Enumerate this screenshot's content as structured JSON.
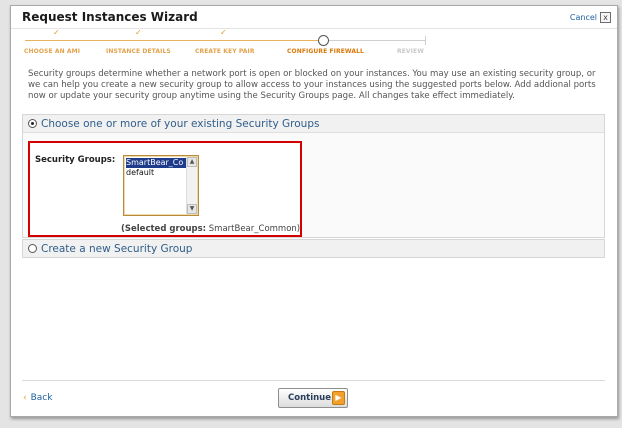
{
  "window": {
    "title": "Request Instances Wizard",
    "cancel_label": "Cancel",
    "close_glyph": "x"
  },
  "steps": [
    {
      "label": "CHOOSE AN AMI",
      "state": "done",
      "mark": "✓"
    },
    {
      "label": "INSTANCE DETAILS",
      "state": "done",
      "mark": "✓"
    },
    {
      "label": "CREATE KEY PAIR",
      "state": "done",
      "mark": "✓"
    },
    {
      "label": "CONFIGURE FIREWALL",
      "state": "current"
    },
    {
      "label": "REVIEW",
      "state": "future"
    }
  ],
  "intro_text": "Security groups determine whether a network port is open or blocked on your instances. You may use an existing security group, or we can help you create a new security group to allow access to your instances using the suggested ports below. Add addional ports now or update your security group anytime using the Security Groups page. All changes take effect immediately.",
  "existing_option": {
    "label": "Choose one or more of your existing Security Groups",
    "selected": true
  },
  "security_groups": {
    "label": "Security Groups:",
    "options": [
      "SmartBear_Co",
      "default"
    ],
    "selected_index": 0,
    "selected_prefix": "(Selected groups:",
    "selected_value": " SmartBear_Common)"
  },
  "new_option": {
    "label": "Create a new Security Group",
    "selected": false
  },
  "footer": {
    "back_label": "Back",
    "back_chevron": "‹",
    "continue_label": "Continue",
    "continue_arrow": "▶"
  },
  "colors": {
    "accent_orange": "#f1a02c",
    "highlight_red": "#d40000",
    "link_blue": "#1d5f9e"
  }
}
